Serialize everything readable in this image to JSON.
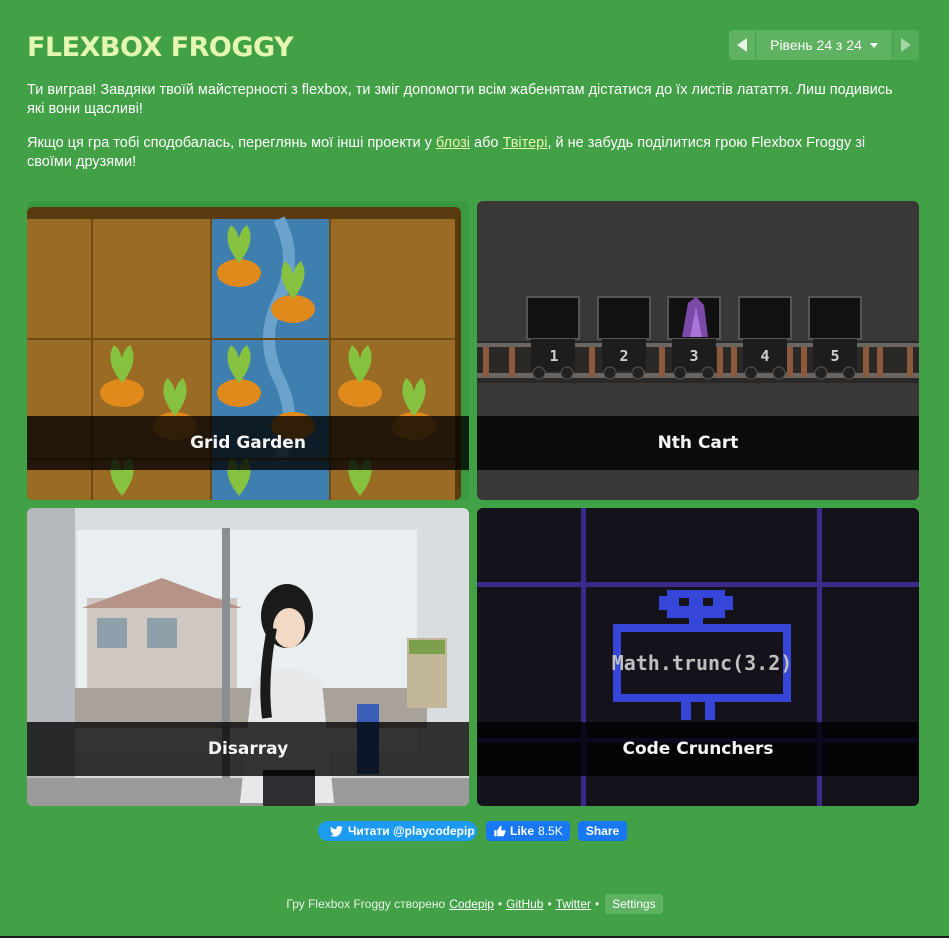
{
  "header": {
    "title": "FLEXBOX FROGGY",
    "level_label": "Рівень 24 з 24",
    "prev_icon": "left-arrow-icon",
    "next_icon": "right-arrow-icon"
  },
  "message": {
    "p1": "Ти виграв! Завдяки твоїй майстерності з flexbox, ти зміг допомогти всім жабенятам дістатися до їх листів латаття. Лиш подивись які вони щасливі!",
    "p2_before": "Якщо ця гра тобі сподобалась, переглянь мої інші проекти у ",
    "p2_link1": "блозі",
    "p2_mid": " або ",
    "p2_link2": "Твітері",
    "p2_after": ", й не забудь поділитися грою Flexbox Froggy зі своїми друзями!"
  },
  "games": {
    "grid_garden": "Grid Garden",
    "nth_cart": "Nth Cart",
    "disarray": "Disarray",
    "code_crunchers": "Code Crunchers",
    "cart_numbers": [
      "1",
      "2",
      "3",
      "4",
      "5"
    ],
    "code_text": "Math.trunc(3.2)"
  },
  "social": {
    "twitter_label": "Читати @playcodepip",
    "like_label": "Like",
    "like_count": "8.5K",
    "share_label": "Share"
  },
  "footer": {
    "prefix": "Гру Flexbox Froggy створено",
    "codepip": "Codepip",
    "github": "GitHub",
    "twitter": "Twitter",
    "settings": "Settings",
    "separator": "•"
  },
  "colors": {
    "background": "#42a047",
    "title": "#e4f7b0",
    "nav": "#5fb262",
    "twitter": "#1d9bf0",
    "facebook": "#1877f2"
  }
}
